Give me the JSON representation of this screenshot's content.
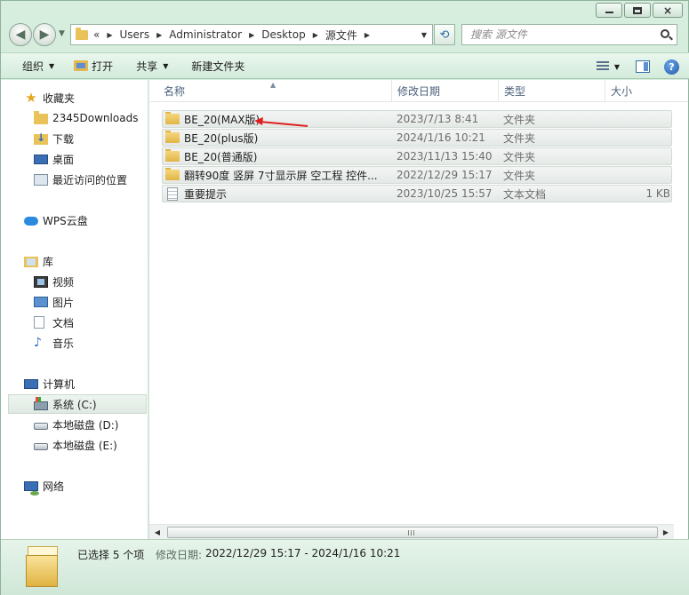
{
  "window": {
    "controls": {
      "minimize": "",
      "maximize": "",
      "close": "×"
    }
  },
  "nav": {
    "back_label": "◀",
    "forward_label": "▶",
    "address": {
      "overflow": "«",
      "crumbs": [
        "Users",
        "Administrator",
        "Desktop",
        "源文件"
      ]
    },
    "search": {
      "placeholder": "搜索 源文件"
    }
  },
  "toolbar": {
    "organize": "组织",
    "open": "打开",
    "share": "共享",
    "new_folder": "新建文件夹"
  },
  "sidebar": {
    "favorites": {
      "label": "收藏夹",
      "items": [
        "2345Downloads",
        "下载",
        "桌面",
        "最近访问的位置"
      ]
    },
    "wps": {
      "label": "WPS云盘"
    },
    "library": {
      "label": "库",
      "items": [
        "视频",
        "图片",
        "文档",
        "音乐"
      ]
    },
    "computer": {
      "label": "计算机",
      "items": [
        "系统 (C:)",
        "本地磁盘 (D:)",
        "本地磁盘 (E:)"
      ]
    },
    "network": {
      "label": "网络"
    }
  },
  "columns": {
    "name": "名称",
    "date": "修改日期",
    "type": "类型",
    "size": "大小"
  },
  "files": [
    {
      "name": "BE_20(MAX版)",
      "date": "2023/7/13 8:41",
      "type": "文件夹",
      "size": "",
      "icon": "folder-icon"
    },
    {
      "name": "BE_20(plus版)",
      "date": "2024/1/16 10:21",
      "type": "文件夹",
      "size": "",
      "icon": "folder-icon"
    },
    {
      "name": "BE_20(普通版)",
      "date": "2023/11/13 15:40",
      "type": "文件夹",
      "size": "",
      "icon": "folder-icon"
    },
    {
      "name": "翻转90度 竖屏 7寸显示屏 空工程 控件...",
      "date": "2022/12/29 15:17",
      "type": "文件夹",
      "size": "",
      "icon": "folder-icon"
    },
    {
      "name": "重要提示",
      "date": "2023/10/25 15:57",
      "type": "文本文档",
      "size": "1 KB",
      "icon": "text-file-icon"
    }
  ],
  "details": {
    "selection": "已选择 5 个项",
    "modified_label": "修改日期:",
    "modified_range": "2022/12/29 15:17 - 2024/1/16 10:21"
  },
  "colors": {
    "window_frame": "#c6e3cf",
    "annotation_arrow": "#e02020",
    "folder": "#e2b545"
  }
}
